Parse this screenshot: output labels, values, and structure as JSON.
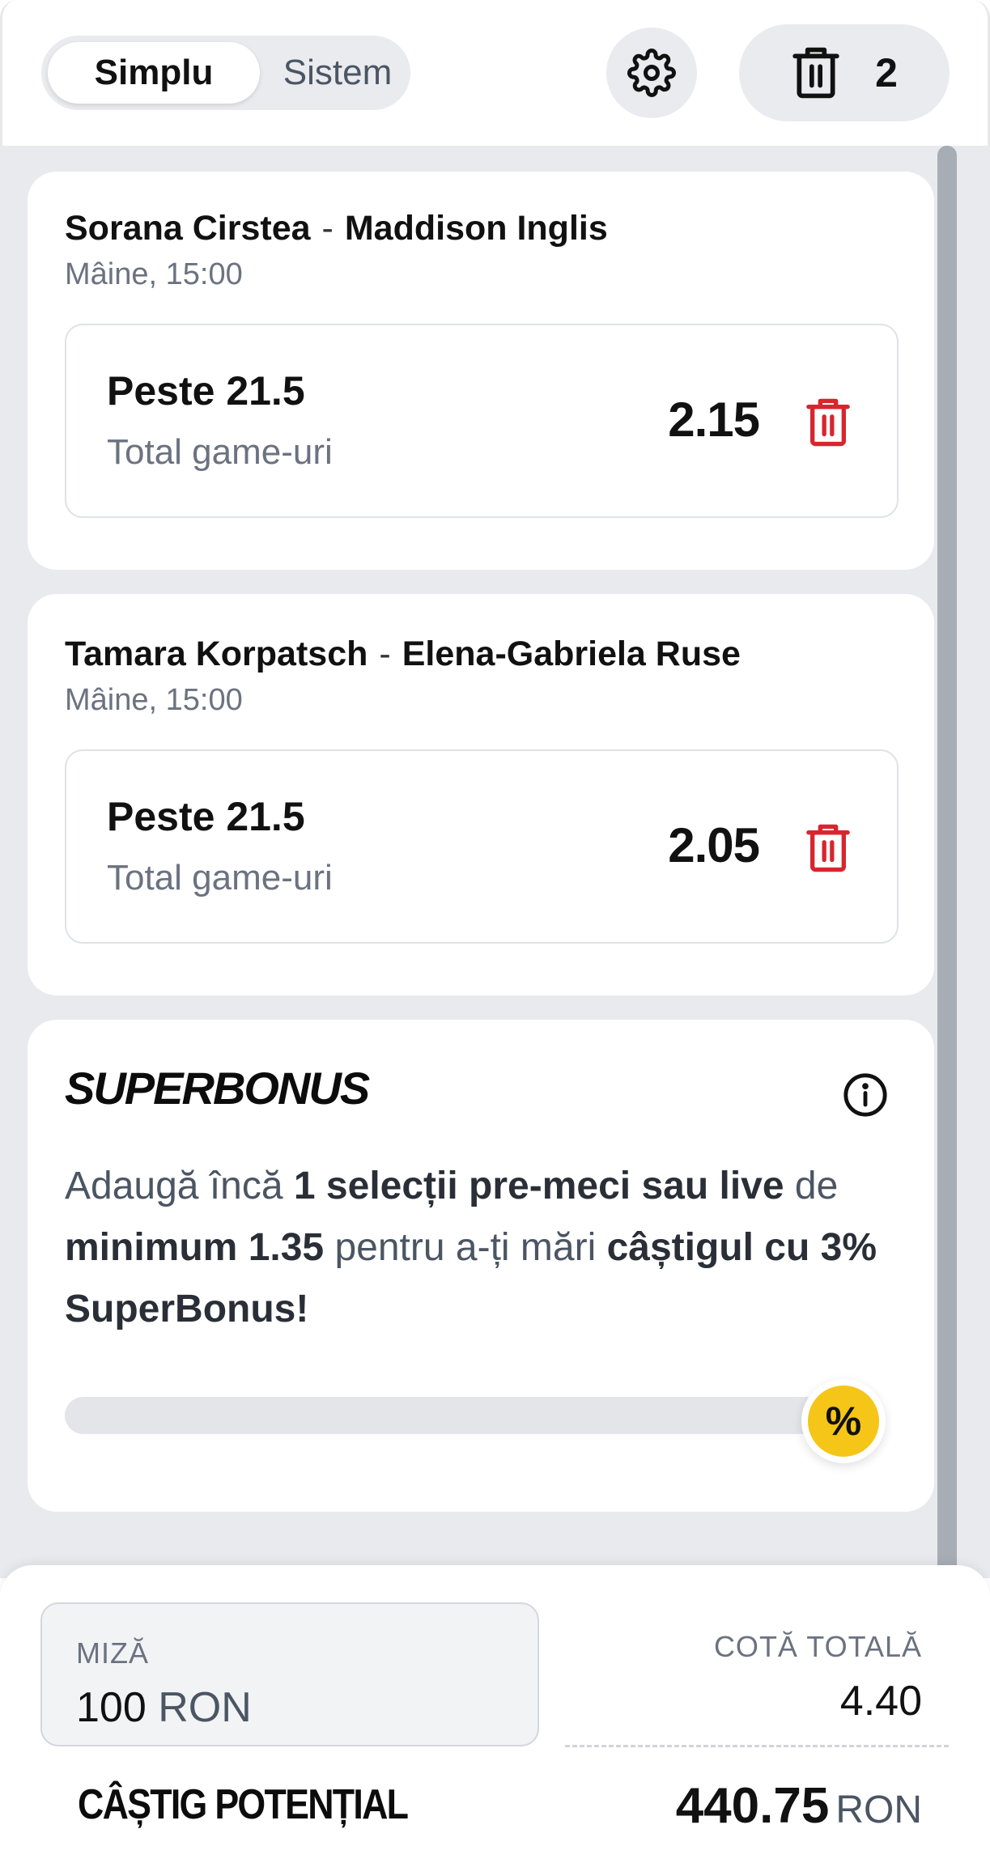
{
  "header": {
    "mode_options": [
      "Simplu",
      "Sistem"
    ],
    "active_mode": "Simplu",
    "settings_icon": "gear-icon",
    "clear_icon": "trash-icon",
    "selection_count": "2"
  },
  "bets": [
    {
      "home": "Sorana Cirstea",
      "separator": "-",
      "away": "Maddison Inglis",
      "time": "Mâine, 15:00",
      "selection": "Peste 21.5",
      "market": "Total game-uri",
      "odds": "2.15",
      "delete_icon": "trash-icon"
    },
    {
      "home": "Tamara Korpatsch",
      "separator": "-",
      "away": "Elena-Gabriela Ruse",
      "time": "Mâine, 15:00",
      "selection": "Peste 21.5",
      "market": "Total game-uri",
      "odds": "2.05",
      "delete_icon": "trash-icon"
    }
  ],
  "superbonus": {
    "title": "SUPERBONUS",
    "info_icon": "info-icon",
    "text_1": "Adaugă încă ",
    "text_2": "1 selecții pre-meci sau live",
    "text_3": " de ",
    "text_4": "minimum 1.35",
    "text_5": " pentru a-ți mări ",
    "text_6": "câștigul cu 3% SuperBonus!",
    "progress": 0,
    "badge": "%",
    "badge_color": "#f5c518"
  },
  "footer": {
    "stake_label": "MIZĂ",
    "stake_amount": "100",
    "stake_currency": "RON",
    "total_odds_label": "COTĂ TOTALĂ",
    "total_odds": "4.40",
    "potential_win_label": "CÂȘTIG POTENȚIAL",
    "potential_win": "440.75",
    "potential_win_currency": "RON"
  },
  "colors": {
    "delete_red": "#d7262e",
    "panel_bg": "#e8eaee",
    "scrollbar": "#a7adb4"
  }
}
